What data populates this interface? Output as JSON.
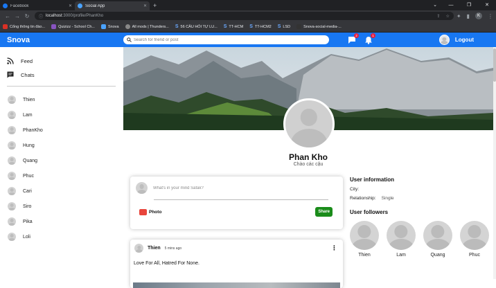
{
  "browser": {
    "tabs": [
      {
        "label": "Facebook",
        "color": "#1877f2",
        "active": false
      },
      {
        "label": "Social App",
        "color": "#f4b400",
        "active": true
      }
    ],
    "url_host": "localhost",
    "url_path": ":3000/profile/PhanKho",
    "profile_initial": "K",
    "bookmarks": [
      {
        "label": "Cổng thông tin đào...",
        "color": "#d93025"
      },
      {
        "label": "Quizizz - School Ch...",
        "color": "#8854c0"
      },
      {
        "label": "Snova",
        "color": "#4aa3ff"
      },
      {
        "label": "All mods | Thunders...",
        "color": "#888888"
      },
      {
        "label": "56 CÂU HỎI TỰ LU...",
        "icon": "S"
      },
      {
        "label": "TT-HCM",
        "icon": "S"
      },
      {
        "label": "TT-HCM2",
        "icon": "S"
      },
      {
        "label": "LSD",
        "icon": "S"
      },
      {
        "label": "Snova-social-media-...",
        "color": "#333333"
      }
    ]
  },
  "app": {
    "logo": "Snova",
    "search_placeholder": "Search for friend or post",
    "chat_badge": "2",
    "notif_badge": "1",
    "logout": "Logout"
  },
  "sidebar": {
    "menu": [
      {
        "label": "Feed",
        "icon": "rss-icon"
      },
      {
        "label": "Chats",
        "icon": "chat-icon"
      }
    ],
    "friends": [
      "Thien",
      "Lam",
      "PhanKho",
      "Hung",
      "Quang",
      "Phuc",
      "Cari",
      "Siro",
      "Pika",
      "Loli"
    ]
  },
  "profile": {
    "name": "Phan Kho",
    "description": "Chào các cậu"
  },
  "share": {
    "placeholder": "What's in your mind Safak?",
    "photo_label": "Photo",
    "share_label": "Share"
  },
  "post": {
    "user": "Thien",
    "time": "5 mins ago",
    "text": "Love For All, Hatred For None."
  },
  "rightbar": {
    "info_title": "User information",
    "city_label": "City:",
    "city_value": "",
    "relationship_label": "Relationship:",
    "relationship_value": "Single",
    "followers_title": "User followers",
    "followers": [
      "Thien",
      "Lam",
      "Quang",
      "Phuc"
    ]
  }
}
